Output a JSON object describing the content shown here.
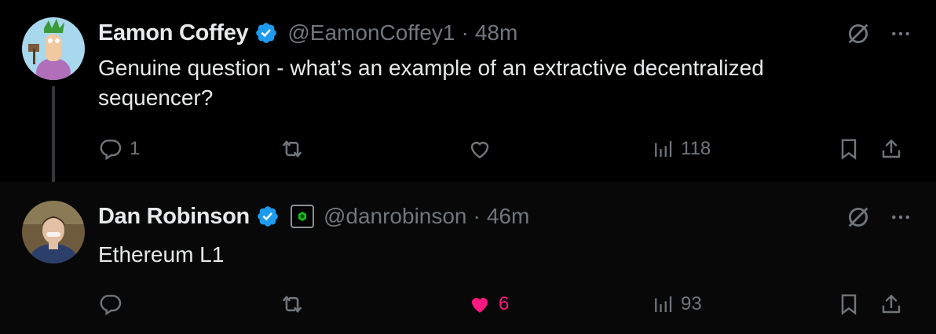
{
  "tweets": [
    {
      "author": {
        "name": "Eamon Coffey",
        "handle": "@EamonCoffey1",
        "time": "48m",
        "verified": true
      },
      "text": "Genuine question - what’s an example of an extractive decentralized sequencer?",
      "stats": {
        "replies": "1",
        "retweets": "",
        "likes": "",
        "views": "118"
      },
      "liked": false,
      "icons": {
        "grok": "no-sign-icon",
        "more": "more-icon"
      }
    },
    {
      "author": {
        "name": "Dan Robinson",
        "handle": "@danrobinson",
        "time": "46m",
        "verified": true,
        "affiliate_badge": "paradigm-badge-icon"
      },
      "text": "Ethereum L1",
      "stats": {
        "replies": "",
        "retweets": "",
        "likes": "6",
        "views": "93"
      },
      "liked": true,
      "icons": {
        "grok": "no-sign-icon",
        "more": "more-icon"
      }
    }
  ],
  "colors": {
    "background": "#000000",
    "text": "#e7e9ea",
    "muted": "#71767b",
    "verified": "#1d9bf0",
    "like": "#f91880"
  }
}
